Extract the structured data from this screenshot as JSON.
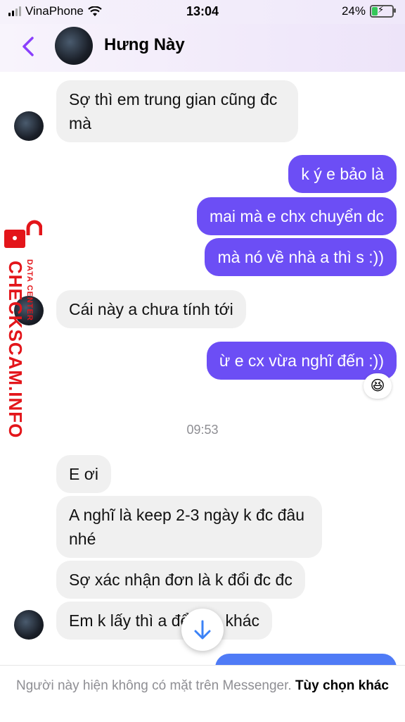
{
  "status": {
    "carrier": "VinaPhone",
    "time": "13:04",
    "battery": "24%"
  },
  "header": {
    "contact_name": "Hưng Này"
  },
  "messages": [
    {
      "from": "them",
      "text": "Sợ thì em trung gian cũng đc mà"
    },
    {
      "from": "me",
      "text": "k ý e bảo là"
    },
    {
      "from": "me",
      "text": "mai mà e chx chuyển dc"
    },
    {
      "from": "me",
      "text": "mà nó về nhà a thì s :))"
    },
    {
      "from": "them",
      "text": "Cái này a chưa tính tới"
    },
    {
      "from": "me",
      "text": "ừ e cx vừa nghĩ đến :))"
    },
    {
      "from": "them",
      "text": "E ơi"
    },
    {
      "from": "them",
      "text": "A nghĩ là keep 2-3 ngày k đc đâu nhé"
    },
    {
      "from": "them",
      "text": "Sợ xác nhận đơn là k đổi đc đc"
    },
    {
      "from": "them",
      "text": "Em k lấy thì a để bạn khác"
    }
  ],
  "reaction": "😆",
  "time_separator": "09:53",
  "watermark": {
    "main": "CHECKSCAM.INFO",
    "sub": "DATA CENTER"
  },
  "footer": {
    "notice": "Người này hiện không có mặt trên Messenger.",
    "action": "Tùy chọn khác"
  },
  "colors": {
    "outgoing": "#6c4ef5",
    "incoming": "#f0f0f0",
    "accent": "#8a3ffc",
    "watermark": "#e3151a"
  }
}
